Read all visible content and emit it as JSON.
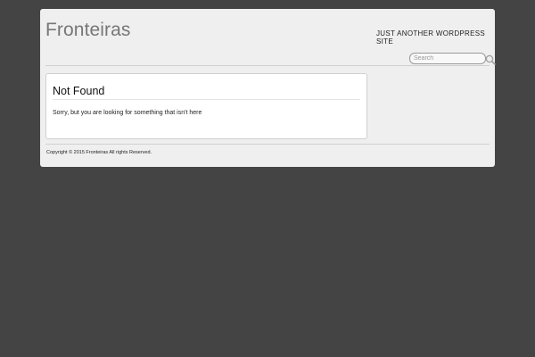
{
  "header": {
    "site_title": "Fronteiras",
    "tagline": "JUST ANOTHER WORDPRESS SITE"
  },
  "search": {
    "placeholder": "Search",
    "icon": "search-icon"
  },
  "main": {
    "title": "Not Found",
    "message": "Sorry, but you are looking for something that isn't here"
  },
  "footer": {
    "copyright": "Copyright © 2015 Fronteiras All rights Reserved."
  },
  "colors": {
    "background": "#444444",
    "page": "#efefef",
    "title": "#777777"
  }
}
